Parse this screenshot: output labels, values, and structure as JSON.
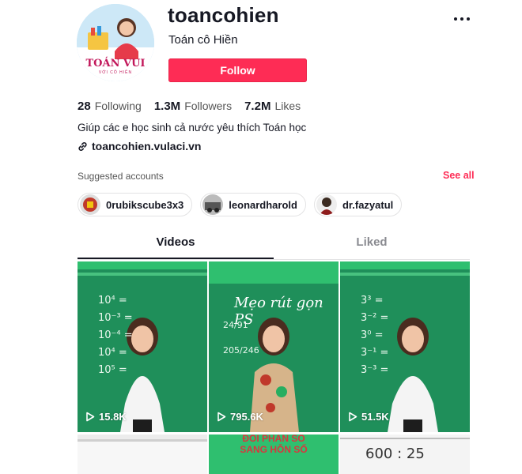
{
  "profile": {
    "username": "toancohien",
    "nickname": "Toán cô Hiền",
    "follow_label": "Follow",
    "avatar_brand": "TOÁN VUI",
    "avatar_sub": "VỚI CÔ HIỀN",
    "bio": "Giúp các e học sinh cả nước yêu thích Toán học",
    "link": "toancohien.vulaci.vn"
  },
  "stats": [
    {
      "num": "28",
      "label": "Following"
    },
    {
      "num": "1.3M",
      "label": "Followers"
    },
    {
      "num": "7.2M",
      "label": "Likes"
    }
  ],
  "suggested": {
    "title": "Suggested accounts",
    "see_all": "See all",
    "accounts": [
      "0rubikscube3x3",
      "leonardharold",
      "dr.fazyatul"
    ]
  },
  "tabs": {
    "videos": "Videos",
    "liked": "Liked"
  },
  "videos": [
    {
      "views": "15.8K",
      "board_text": [
        "10⁴ =",
        "10⁻³ =",
        "10⁻⁴ =",
        "10⁴ =",
        "10⁵ ="
      ]
    },
    {
      "views": "795.6K",
      "board_title": "Mẹo rút gọn PS",
      "board_text": [
        "24/91",
        "205/246"
      ]
    },
    {
      "views": "51.5K",
      "board_text": [
        "3³ =",
        "3⁻² =",
        "3⁰ =",
        "3⁻¹ =",
        "3⁻³ ="
      ]
    }
  ],
  "second_row": [
    {
      "board_text": ""
    },
    {
      "banner": [
        "ĐỔI PHÂN SỐ",
        "SANG HỖN SỐ"
      ]
    },
    {
      "board_text": "600 : 25"
    }
  ],
  "colors": {
    "accent": "#fe2c55",
    "board": "#1f9a62"
  }
}
